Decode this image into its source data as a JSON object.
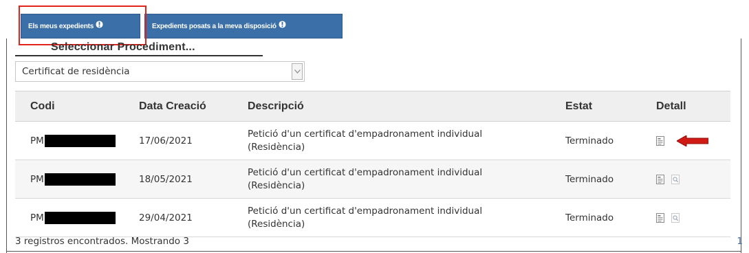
{
  "tabs": [
    {
      "label": "Els meus expedients",
      "icon": "info-icon",
      "active": true
    },
    {
      "label": "Expedients posats a la meva disposició",
      "icon": "info-icon",
      "active": false
    }
  ],
  "procedure": {
    "heading": "Seleccionar Procediment...",
    "selected": "Certificat de residència"
  },
  "table": {
    "headers": [
      "Codi",
      "Data Creació",
      "Descripció",
      "Estat",
      "Detall"
    ],
    "rows": [
      {
        "codi": "PM",
        "data": "17/06/2021",
        "desc_line1": "Petició d'un certificat d'empadronament individual",
        "desc_line2": "(Residència)",
        "estat": "Terminado",
        "icons": [
          "document-icon"
        ],
        "annotated": true
      },
      {
        "codi": "PM",
        "data": "18/05/2021",
        "desc_line1": "Petició d'un certificat d'empadronament individual",
        "desc_line2": "(Residència)",
        "estat": "Terminado",
        "icons": [
          "document-icon",
          "zoom-icon"
        ],
        "annotated": false
      },
      {
        "codi": "PM",
        "data": "29/04/2021",
        "desc_line1": "Petició d'un certificat d'empadronament individual",
        "desc_line2": "(Residència)",
        "estat": "Terminado",
        "icons": [
          "document-icon",
          "zoom-icon"
        ],
        "annotated": false
      }
    ]
  },
  "footer": {
    "summary": "3 registros encontrados. Mostrando 3",
    "page": "1"
  },
  "colors": {
    "tab_bg": "#3b6fa8",
    "highlight": "#e0241c",
    "arrow": "#d11a14"
  }
}
